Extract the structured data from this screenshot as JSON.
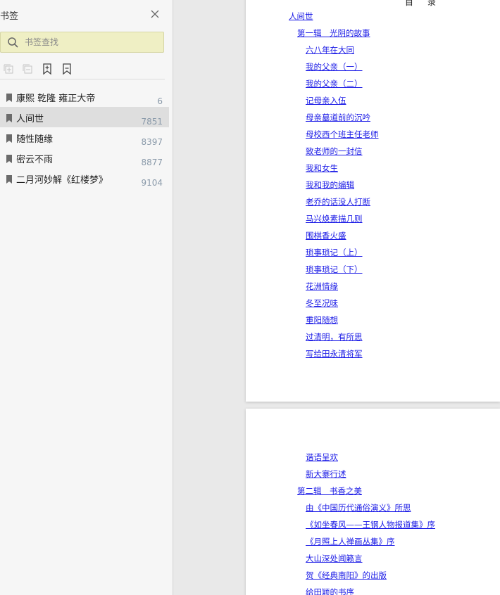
{
  "sidebar": {
    "title": "书签",
    "search": {
      "placeholder": "书签查找",
      "value": ""
    },
    "bookmarks": [
      {
        "label": "康熙 乾隆 雍正大帝",
        "page": "6"
      },
      {
        "label": "人间世",
        "page": "7851"
      },
      {
        "label": "随性随缘",
        "page": "8397"
      },
      {
        "label": "密云不雨",
        "page": "8877"
      },
      {
        "label": "二月河妙解《红楼梦》",
        "page": "9104"
      }
    ],
    "toolbar_icons": [
      "expand-all-icon",
      "collapse-all-icon",
      "add-bookmark-icon",
      "bookmark-icon"
    ]
  },
  "document": {
    "page1": {
      "heading": "目 录",
      "entries": [
        "人间世",
        "第一辑　光阴的故事",
        "六八年在大同",
        "我的父亲（一）",
        "我的父亲（二）",
        "记母亲入伍",
        "母亲墓道前的沉吟",
        "母校西个班主任老师",
        "致老师的一封信",
        "我和女生",
        "我和我的编辑",
        "老乔的话没人打断",
        "马兴焕素描几则",
        "围棋香火盛",
        "琐事琐记（上）",
        "琐事琐记（下）",
        "花洲情缘",
        "冬至况味",
        "重阳随想",
        "过清明，有所思",
        "写给田永清将军"
      ]
    },
    "page2": {
      "entries": [
        "谐语呈欢",
        "新大寨行述",
        "第二辑　书香之美",
        "由《中国历代通俗演义》所思",
        "《如坐春风——王钢人物报道集》序",
        "《月照上人禅画丛集》序",
        "大山深处闻籁言",
        "贺《经典南阳》的出版",
        "给田颖的书序"
      ]
    }
  }
}
